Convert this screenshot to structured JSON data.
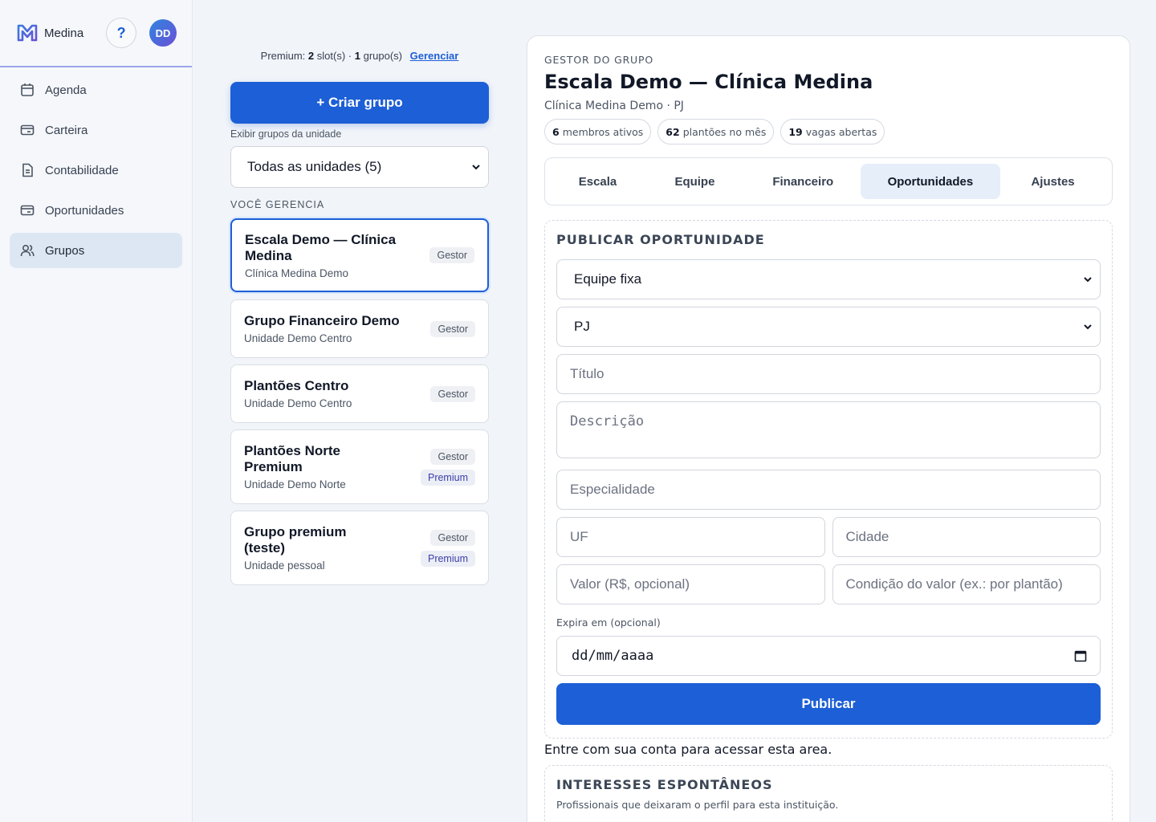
{
  "app": {
    "name": "Medina",
    "help": "?",
    "avatar_initials": "DD",
    "accent": "#1d5fd6"
  },
  "sidebar": {
    "items": [
      {
        "label": "Agenda",
        "icon": "calendar-icon"
      },
      {
        "label": "Carteira",
        "icon": "wallet-icon"
      },
      {
        "label": "Contabilidade",
        "icon": "document-icon"
      },
      {
        "label": "Oportunidades",
        "icon": "wallet-icon"
      },
      {
        "label": "Grupos",
        "icon": "users-icon",
        "active": true
      }
    ]
  },
  "groups_column": {
    "premium_prefix": "Premium:",
    "slots_count": "2",
    "slots_text": "slot(s) ·",
    "groups_count": "1",
    "groups_text": "grupo(s)",
    "manage_link": "Gerenciar",
    "create_button": "+ Criar grupo",
    "unit_filter_label": "Exibir grupos da unidade",
    "unit_filter_value": "Todas as unidades (5)",
    "section_label": "VOCÊ GERENCIA",
    "groups": [
      {
        "name_line1": "Escala Demo — Clínica",
        "name_line2": "Medina",
        "unit": "Clínica Medina Demo",
        "badges": [
          "Gestor"
        ]
      },
      {
        "name_line1": "Grupo Financeiro Demo",
        "name_line2": "",
        "unit": "Unidade Demo Centro",
        "badges": [
          "Gestor"
        ]
      },
      {
        "name_line1": "Plantões Centro",
        "name_line2": "",
        "unit": "Unidade Demo Centro",
        "badges": [
          "Gestor"
        ]
      },
      {
        "name_line1": "Plantões Norte",
        "name_line2": "Premium",
        "unit": "Unidade Demo Norte",
        "badges": [
          "Gestor",
          "Premium"
        ]
      },
      {
        "name_line1": "Grupo premium",
        "name_line2": "(teste)",
        "unit": "Unidade pessoal",
        "badges": [
          "Gestor",
          "Premium"
        ]
      }
    ]
  },
  "panel": {
    "kicker": "GESTOR DO GRUPO",
    "title": "Escala Demo — Clínica Medina",
    "subtitle": "Clínica Medina Demo · PJ",
    "stats": [
      {
        "value": "6",
        "label": "membros ativos"
      },
      {
        "value": "62",
        "label": "plantões no mês"
      },
      {
        "value": "19",
        "label": "vagas abertas"
      }
    ],
    "tabs": [
      "Escala",
      "Equipe",
      "Financeiro",
      "Oportunidades",
      "Ajustes"
    ],
    "active_tab": "Oportunidades",
    "form": {
      "title": "PUBLICAR OPORTUNIDADE",
      "type_value": "Equipe fixa",
      "regime_value": "PJ",
      "title_placeholder": "Título",
      "description_placeholder": "Descrição",
      "specialty_placeholder": "Especialidade",
      "uf_placeholder": "UF",
      "city_placeholder": "Cidade",
      "value_placeholder": "Valor (R$, opcional)",
      "value_condition_placeholder": "Condição do valor (ex.: por plantão)",
      "expires_label": "Expira em (opcional)",
      "expires_value": "dd/mm/aaaa",
      "publish_button": "Publicar"
    },
    "login_message": "Entre com sua conta para acessar esta area.",
    "interests": {
      "title": "INTERESSES ESPONTÂNEOS",
      "description": "Profissionais que deixaram o perfil para esta instituição."
    }
  }
}
